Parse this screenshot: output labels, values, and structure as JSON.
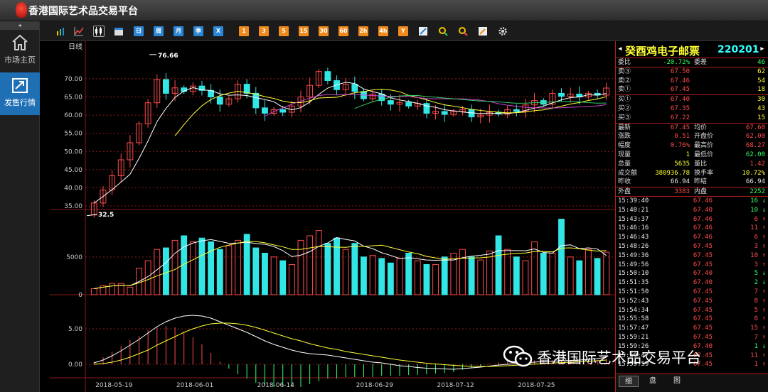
{
  "app": {
    "title": "香港国际艺术品交易平台"
  },
  "nav": {
    "collapse": "◂",
    "items": [
      {
        "label": "市场主页"
      },
      {
        "label": "发售行情"
      }
    ]
  },
  "toolbar": {
    "buttons": [
      "日",
      "周",
      "月",
      "季",
      "X",
      "1",
      "3",
      "5",
      "15",
      "30",
      "60",
      "2h",
      "4h",
      "Y"
    ]
  },
  "chart_data": {
    "type": "candlestick",
    "title": "日线",
    "x_ticks": [
      "2018-05-19",
      "2018-06-01",
      "2018-06-14",
      "2018-06-29",
      "2018-07-12",
      "2018-07-25"
    ],
    "price_axis": {
      "ticks": [
        "70.00",
        "65.00",
        "60.00",
        "55.00",
        "50.00",
        "45.00",
        "40.00",
        "35.00"
      ],
      "ylim": [
        35,
        78
      ]
    },
    "annotations": {
      "high_label": "76.66",
      "low_label": "32.5"
    },
    "candles": [
      {
        "o": 32.5,
        "c": 35.8
      },
      {
        "o": 35.8,
        "c": 39.4
      },
      {
        "o": 39.4,
        "c": 43.3
      },
      {
        "o": 43.3,
        "c": 47.7
      },
      {
        "o": 47.7,
        "c": 52.4
      },
      {
        "o": 52.4,
        "c": 57.6
      },
      {
        "o": 57.6,
        "c": 63.4
      },
      {
        "o": 63.4,
        "c": 69.8
      },
      {
        "o": 69.8,
        "c": 66.0
      },
      {
        "o": 66.0,
        "c": 67.5
      },
      {
        "o": 67.5,
        "c": 66.5
      },
      {
        "o": 66.5,
        "c": 68.0
      },
      {
        "o": 68.0,
        "c": 66.8
      },
      {
        "o": 66.8,
        "c": 65.0
      },
      {
        "o": 65.0,
        "c": 63.0
      },
      {
        "o": 63.0,
        "c": 64.5
      },
      {
        "o": 64.5,
        "c": 68.5
      },
      {
        "o": 68.5,
        "c": 66.0
      },
      {
        "o": 66.0,
        "c": 62.0
      },
      {
        "o": 62.0,
        "c": 60.5
      },
      {
        "o": 60.5,
        "c": 61.5
      },
      {
        "o": 61.5,
        "c": 60.8
      },
      {
        "o": 60.8,
        "c": 62.5
      },
      {
        "o": 62.5,
        "c": 65.0
      },
      {
        "o": 65.0,
        "c": 68.2
      },
      {
        "o": 68.2,
        "c": 72.0
      },
      {
        "o": 72.0,
        "c": 69.5
      },
      {
        "o": 69.5,
        "c": 67.0
      },
      {
        "o": 67.0,
        "c": 68.5
      },
      {
        "o": 68.5,
        "c": 66.5
      },
      {
        "o": 66.5,
        "c": 64.5
      },
      {
        "o": 64.5,
        "c": 65.8
      },
      {
        "o": 65.8,
        "c": 64.0
      },
      {
        "o": 64.0,
        "c": 63.0
      },
      {
        "o": 63.0,
        "c": 63.5
      },
      {
        "o": 63.5,
        "c": 62.5
      },
      {
        "o": 62.5,
        "c": 63.2
      },
      {
        "o": 63.2,
        "c": 60.5
      },
      {
        "o": 60.5,
        "c": 61.0
      },
      {
        "o": 61.0,
        "c": 60.2
      },
      {
        "o": 60.2,
        "c": 61.0
      },
      {
        "o": 61.0,
        "c": 61.5
      },
      {
        "o": 61.5,
        "c": 59.5
      },
      {
        "o": 59.5,
        "c": 60.0
      },
      {
        "o": 60.0,
        "c": 60.8
      },
      {
        "o": 60.8,
        "c": 60.3
      },
      {
        "o": 60.3,
        "c": 61.5
      },
      {
        "o": 61.5,
        "c": 61.0
      },
      {
        "o": 61.0,
        "c": 62.8
      },
      {
        "o": 62.8,
        "c": 64.0
      },
      {
        "o": 64.0,
        "c": 63.0
      },
      {
        "o": 63.0,
        "c": 66.0
      },
      {
        "o": 66.0,
        "c": 65.2
      },
      {
        "o": 65.2,
        "c": 65.8
      },
      {
        "o": 65.8,
        "c": 65.0
      },
      {
        "o": 65.0,
        "c": 66.0
      },
      {
        "o": 66.0,
        "c": 65.5
      },
      {
        "o": 65.5,
        "c": 67.45
      }
    ],
    "volume_axis": {
      "ticks": [
        "5000",
        "0"
      ],
      "ylim": [
        0,
        11000
      ]
    },
    "volumes": [
      800,
      1200,
      1500,
      1500,
      1000,
      3500,
      4500,
      6000,
      6200,
      7200,
      7800,
      7000,
      7500,
      7000,
      6000,
      6500,
      7200,
      8000,
      6200,
      5500,
      5000,
      4500,
      4000,
      7200,
      7800,
      8500,
      6800,
      7500,
      6000,
      6800,
      5000,
      5200,
      4800,
      4200,
      4800,
      5500,
      4500,
      4000,
      4000,
      5000,
      5500,
      6000,
      5000,
      4600,
      5800,
      7800,
      6000,
      5000,
      4500,
      7000,
      5500,
      5500,
      10000,
      5000,
      4500,
      6000,
      4800,
      5635
    ],
    "macd_axis": {
      "ticks": [
        "5.00",
        "0.00"
      ],
      "ylim": [
        -1.5,
        8
      ]
    },
    "macd_dif": [
      0.2,
      0.6,
      1.2,
      1.9,
      2.7,
      3.5,
      4.4,
      5.3,
      6.0,
      6.5,
      6.8,
      6.9,
      6.8,
      6.5,
      6.0,
      5.5,
      5.0,
      4.5,
      3.9,
      3.3,
      2.8,
      2.4,
      2.0,
      1.7,
      1.5,
      1.4,
      1.3,
      1.1,
      0.9,
      0.7,
      0.5,
      0.3,
      0.2,
      0.0,
      -0.2,
      -0.3,
      -0.45,
      -0.55,
      -0.6,
      -0.65,
      -0.7,
      -0.6,
      -0.5,
      -0.4,
      -0.25,
      -0.1,
      0.0,
      0.1,
      0.2,
      0.3,
      0.4,
      0.45,
      0.5,
      0.55,
      0.6,
      0.7,
      0.8,
      1.0
    ],
    "macd_dea": [
      0.0,
      0.1,
      0.3,
      0.6,
      1.0,
      1.5,
      2.0,
      2.7,
      3.3,
      3.9,
      4.5,
      5.0,
      5.4,
      5.7,
      5.8,
      5.8,
      5.7,
      5.5,
      5.2,
      4.8,
      4.4,
      4.0,
      3.6,
      3.3,
      2.9,
      2.6,
      2.3,
      2.1,
      1.8,
      1.6,
      1.4,
      1.2,
      1.0,
      0.8,
      0.6,
      0.45,
      0.3,
      0.15,
      0.05,
      -0.05,
      -0.15,
      -0.22,
      -0.28,
      -0.3,
      -0.3,
      -0.25,
      -0.2,
      -0.12,
      -0.05,
      0.02,
      0.1,
      0.17,
      0.24,
      0.3,
      0.36,
      0.42,
      0.5,
      0.6
    ]
  },
  "quote": {
    "name": "癸酉鸡电子邮票",
    "code": "220201",
    "wei": {
      "l1": "委比",
      "v1": "-20.72%",
      "l2": "委差",
      "v2": "46"
    },
    "asks": [
      {
        "label": "卖③",
        "price": "67.50",
        "vol": "62"
      },
      {
        "label": "卖②",
        "price": "67.46",
        "vol": "54"
      },
      {
        "label": "卖①",
        "price": "67.45",
        "vol": "18"
      }
    ],
    "bids": [
      {
        "label": "买①",
        "price": "67.40",
        "vol": "30"
      },
      {
        "label": "买②",
        "price": "67.35",
        "vol": "43"
      },
      {
        "label": "买③",
        "price": "67.22",
        "vol": "15"
      }
    ],
    "stats": [
      {
        "l1": "最新",
        "v1": "67.45",
        "l2": "均价",
        "v2": "67.60"
      },
      {
        "l1": "涨跌",
        "v1": "0.51",
        "l2": "开盘价",
        "v2": "62.00"
      },
      {
        "l1": "幅度",
        "v1": "0.76%",
        "l2": "最高价",
        "v2": "68.27"
      },
      {
        "l1": "现量",
        "v1": "1",
        "l2": "最低价",
        "v2": "62.00"
      },
      {
        "l1": "总量",
        "v1": "5635",
        "l2": "量比",
        "v2": "1.42"
      },
      {
        "l1": "成交额",
        "v1": "380936.78",
        "l2": "换手率",
        "v2": "10.72%"
      },
      {
        "l1": "昨收",
        "v1": "66.94",
        "l2": "昨结",
        "v2": "66.94"
      }
    ],
    "outer": {
      "l1": "外盘",
      "v1": "3383",
      "l2": "内盘",
      "v2": "2252"
    },
    "ticks": [
      {
        "t": "15:39:40",
        "p": "67.46",
        "v": "16",
        "d": "down"
      },
      {
        "t": "15:40:21",
        "p": "67.40",
        "v": "10",
        "d": "down"
      },
      {
        "t": "15:43:37",
        "p": "67.46",
        "v": "6",
        "d": "up"
      },
      {
        "t": "15:46:16",
        "p": "67.46",
        "v": "11",
        "d": "up"
      },
      {
        "t": "15:46:43",
        "p": "67.46",
        "v": "6",
        "d": "up"
      },
      {
        "t": "15:48:26",
        "p": "67.45",
        "v": "3",
        "d": "up"
      },
      {
        "t": "15:49:36",
        "p": "67.45",
        "v": "10",
        "d": "up"
      },
      {
        "t": "15:49:56",
        "p": "67.45",
        "v": "3",
        "d": "up"
      },
      {
        "t": "15:50:10",
        "p": "67.40",
        "v": "5",
        "d": "down"
      },
      {
        "t": "15:51:35",
        "p": "67.40",
        "v": "2",
        "d": "down"
      },
      {
        "t": "15:51:50",
        "p": "67.45",
        "v": "7",
        "d": "up"
      },
      {
        "t": "15:52:43",
        "p": "67.45",
        "v": "8",
        "d": "up"
      },
      {
        "t": "15:54:34",
        "p": "67.45",
        "v": "5",
        "d": "up"
      },
      {
        "t": "15:55:58",
        "p": "67.45",
        "v": "6",
        "d": "up"
      },
      {
        "t": "15:57:47",
        "p": "67.45",
        "v": "15",
        "d": "up"
      },
      {
        "t": "15:59:21",
        "p": "67.45",
        "v": "7",
        "d": "up"
      },
      {
        "t": "15:59:26",
        "p": "67.40",
        "v": "1",
        "d": "down"
      },
      {
        "t": "15:59:47",
        "p": "67.45",
        "v": "11",
        "d": "up"
      },
      {
        "t": "15:59:59",
        "p": "67.45",
        "v": "1",
        "d": "up"
      }
    ],
    "tabs": [
      "细",
      "盘",
      "图"
    ],
    "colors": {
      "up": "#ff4b4b",
      "down": "#33ff66",
      "grid": "#8b1a1a"
    }
  },
  "watermark": {
    "text": "香港国际艺术品交易平台"
  }
}
